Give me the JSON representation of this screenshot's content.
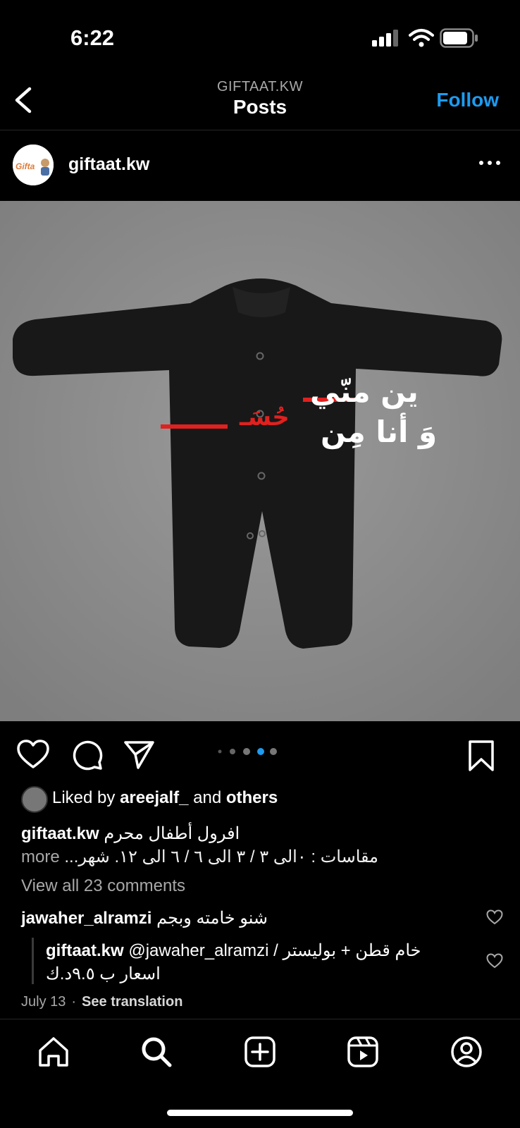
{
  "status": {
    "time": "6:22"
  },
  "header": {
    "account": "GIFTAAT.KW",
    "title": "Posts",
    "follow": "Follow"
  },
  "post": {
    "username": "giftaat.kw",
    "avatar_text": "Gifta",
    "image_text": {
      "line1": "ين منّي",
      "line2": "وَ أنا مِن",
      "red_part": "حُسَـ"
    },
    "carousel": {
      "count": 4,
      "active": 3
    }
  },
  "likes": {
    "prefix": "Liked by",
    "user": "areejalf_",
    "and": "and",
    "others": "others"
  },
  "caption": {
    "username": "giftaat.kw",
    "line1": "افرول أطفال محرم",
    "line2": "مقاسات : ٠الى ٣ / ٣ الى ٦ / ٦ الى ١٢. شهر...",
    "more": "more"
  },
  "view_all": "View all 23 comments",
  "comments": [
    {
      "username": "jawaher_alramzi",
      "text": "شنو خامته وبجم"
    },
    {
      "username": "giftaat.kw",
      "mention": "@jawaher_alramzi",
      "text1": "/ خام قطن + بوليستر",
      "text2": "اسعار ب ٩.٥د.ك"
    }
  ],
  "meta": {
    "date": "July 13",
    "separator": "·",
    "see_translation": "See translation"
  },
  "colors": {
    "accent": "#1d9bf0",
    "background": "#000000",
    "photo_bg": "#8a8a8a",
    "red": "#e0211f"
  }
}
